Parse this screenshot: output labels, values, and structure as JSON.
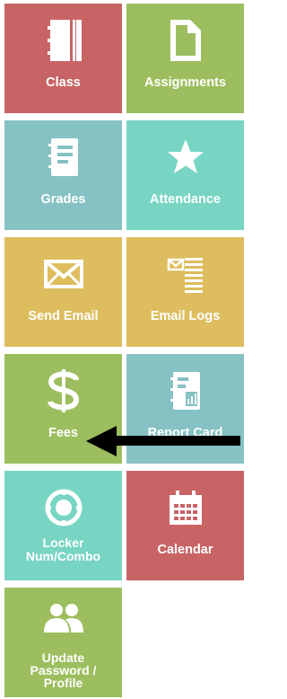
{
  "colors": {
    "red": "#c86466",
    "green": "#9cbe5e",
    "teal": "#86c1c4",
    "mint": "#78d5c4",
    "mustard": "#ddbd5e",
    "arrow": "#000000"
  },
  "tiles": [
    {
      "label": "Class",
      "icon": "notebook-icon",
      "color": "red"
    },
    {
      "label": "Assignments",
      "icon": "document-icon",
      "color": "green"
    },
    {
      "label": "Grades",
      "icon": "gradebook-icon",
      "color": "teal"
    },
    {
      "label": "Attendance",
      "icon": "star-icon",
      "color": "mint"
    },
    {
      "label": "Send Email",
      "icon": "envelope-icon",
      "color": "mustard"
    },
    {
      "label": "Email Logs",
      "icon": "email-log-icon",
      "color": "mustard"
    },
    {
      "label": "Fees",
      "icon": "dollar-icon",
      "color": "green"
    },
    {
      "label": "Report Card",
      "icon": "report-card-icon",
      "color": "teal"
    },
    {
      "label": "Locker Num/Combo",
      "label_lines": [
        "Locker",
        "Num/Combo"
      ],
      "icon": "combination-lock-icon",
      "color": "mint"
    },
    {
      "label": "Calendar",
      "icon": "calendar-icon",
      "color": "red"
    },
    {
      "label": "Update Password / Profile",
      "label_lines": [
        "Update",
        "Password /",
        "Profile"
      ],
      "icon": "users-icon",
      "color": "green"
    }
  ],
  "annotation": {
    "icon": "left-arrow-icon"
  }
}
